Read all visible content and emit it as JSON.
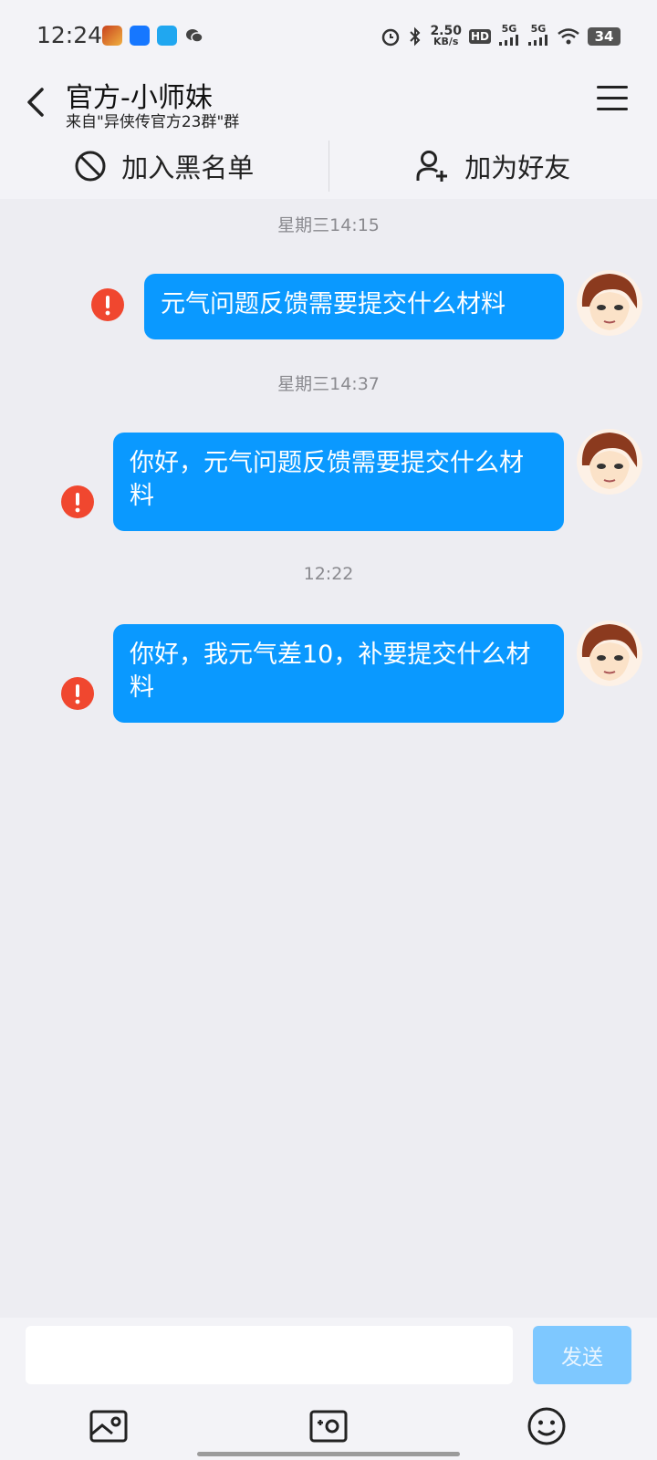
{
  "status_bar": {
    "time": "12:24",
    "net_speed_value": "2.50",
    "net_speed_unit": "KB/s",
    "hd_label": "HD",
    "sim1_label": "5G",
    "sim2_label": "5G",
    "battery": "34"
  },
  "header": {
    "title": "官方-小师妹",
    "subtitle": "来自\"异侠传官方23群\"群"
  },
  "actions": {
    "blacklist_label": "加入黑名单",
    "add_friend_label": "加为好友"
  },
  "messages": [
    {
      "time": "星期三14:15",
      "text": "元气问题反馈需要提交什么材料",
      "status": "failed"
    },
    {
      "time": "星期三14:37",
      "text": "你好，元气问题反馈需要提交什么材料",
      "status": "failed"
    },
    {
      "time": "12:22",
      "text": "你好，我元气差10，补要提交什么材料",
      "status": "failed"
    }
  ],
  "composer": {
    "input_value": "",
    "send_label": "发送"
  },
  "icons": {
    "error": "exclamation-circle-icon",
    "image": "image-icon",
    "camera": "camera-icon",
    "emoji": "emoji-icon"
  },
  "colors": {
    "bubble": "#0a99ff",
    "error": "#f0472f",
    "send_disabled": "#7ec8ff",
    "background": "#ededf2"
  }
}
